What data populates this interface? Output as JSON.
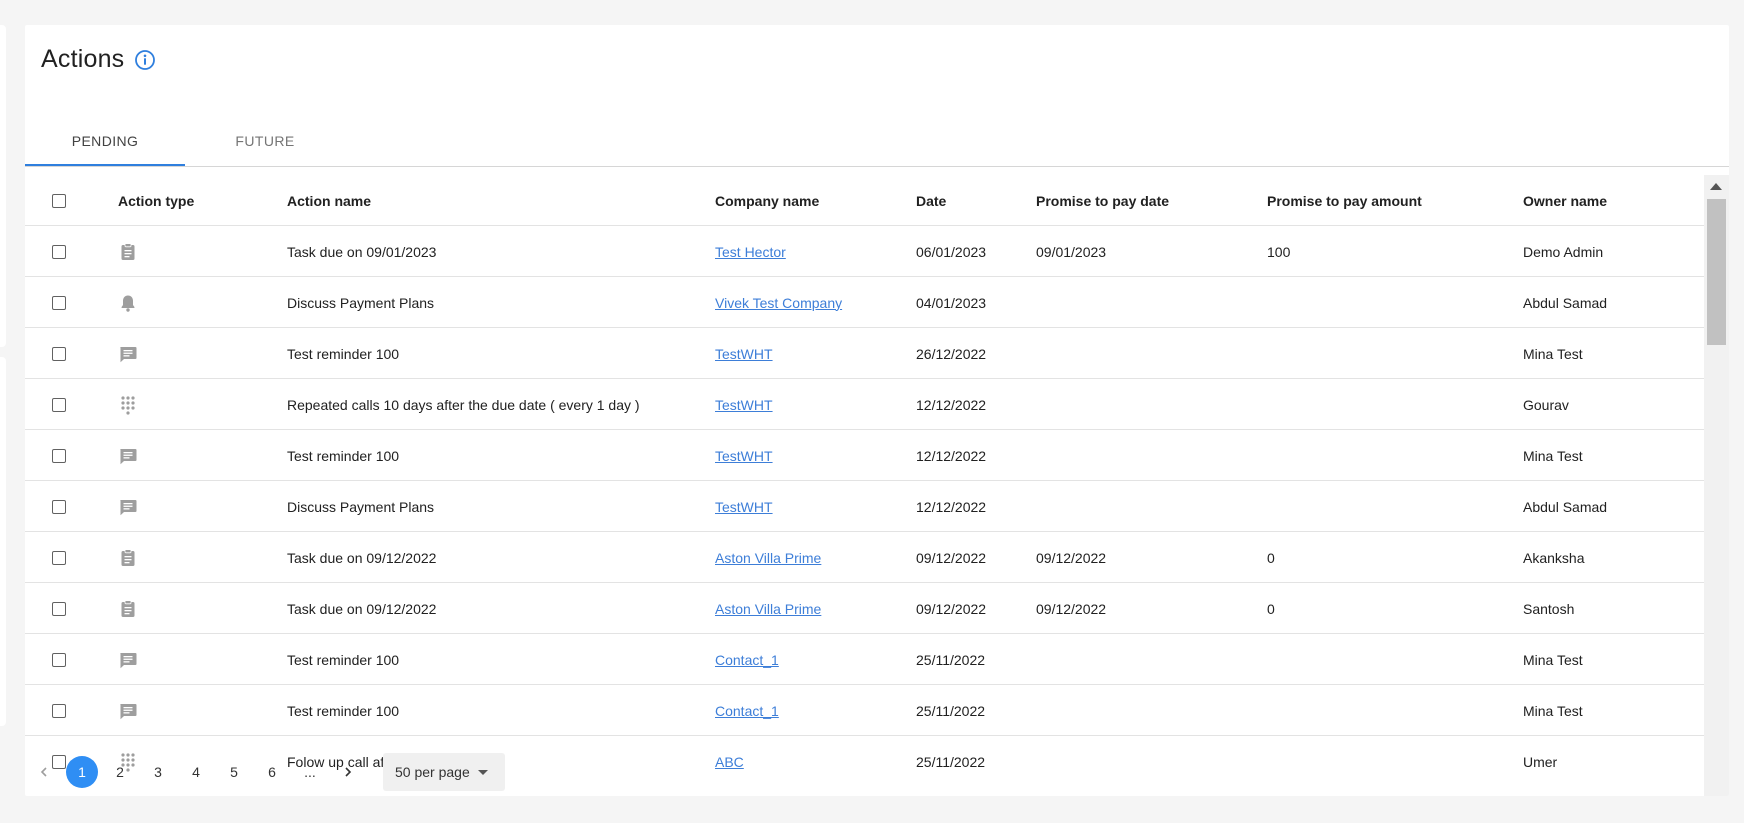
{
  "page": {
    "title": "Actions",
    "info_icon": "info-icon"
  },
  "tabs": [
    {
      "label": "PENDING",
      "active": true
    },
    {
      "label": "FUTURE",
      "active": false
    }
  ],
  "table": {
    "columns": [
      "Action type",
      "Action name",
      "Company name",
      "Date",
      "Promise to pay date",
      "Promise to pay amount",
      "Owner name"
    ],
    "rows": [
      {
        "type": "task",
        "name": "Task due on 09/01/2023",
        "company": "Test Hector",
        "date": "06/01/2023",
        "ptp_date": "09/01/2023",
        "ptp_amount": "100",
        "owner": "Demo Admin"
      },
      {
        "type": "notification",
        "name": "Discuss Payment Plans",
        "company": "Vivek Test Company",
        "date": "04/01/2023",
        "ptp_date": "",
        "ptp_amount": "",
        "owner": "Abdul Samad"
      },
      {
        "type": "message",
        "name": "Test reminder 100",
        "company": "TestWHT",
        "date": "26/12/2022",
        "ptp_date": "",
        "ptp_amount": "",
        "owner": "Mina Test"
      },
      {
        "type": "dialpad",
        "name": "Repeated calls 10 days after the due date ( every 1 day )",
        "company": "TestWHT",
        "date": "12/12/2022",
        "ptp_date": "",
        "ptp_amount": "",
        "owner": "Gourav"
      },
      {
        "type": "message",
        "name": "Test reminder 100",
        "company": "TestWHT",
        "date": "12/12/2022",
        "ptp_date": "",
        "ptp_amount": "",
        "owner": "Mina Test"
      },
      {
        "type": "message",
        "name": "Discuss Payment Plans",
        "company": "TestWHT",
        "date": "12/12/2022",
        "ptp_date": "",
        "ptp_amount": "",
        "owner": "Abdul Samad"
      },
      {
        "type": "task",
        "name": "Task due on 09/12/2022",
        "company": "Aston Villa Prime",
        "date": "09/12/2022",
        "ptp_date": "09/12/2022",
        "ptp_amount": "0",
        "owner": "Akanksha"
      },
      {
        "type": "task",
        "name": "Task due on 09/12/2022",
        "company": "Aston Villa Prime",
        "date": "09/12/2022",
        "ptp_date": "09/12/2022",
        "ptp_amount": "0",
        "owner": "Santosh"
      },
      {
        "type": "message",
        "name": "Test reminder 100",
        "company": "Contact_1",
        "date": "25/11/2022",
        "ptp_date": "",
        "ptp_amount": "",
        "owner": "Mina Test"
      },
      {
        "type": "message",
        "name": "Test reminder 100",
        "company": "Contact_1",
        "date": "25/11/2022",
        "ptp_date": "",
        "ptp_amount": "",
        "owner": "Mina Test"
      },
      {
        "type": "dialpad",
        "name": "Folow up call after due",
        "company": "ABC",
        "date": "25/11/2022",
        "ptp_date": "",
        "ptp_amount": "",
        "owner": "Umer"
      }
    ]
  },
  "pagination": {
    "pages": [
      "1",
      "2",
      "3",
      "4",
      "5",
      "6",
      "..."
    ],
    "current": "1",
    "per_page": "50 per page"
  },
  "colors": {
    "accent": "#2f7fde",
    "link": "#3d7ed8",
    "icon_gray": "#9e9e9e"
  }
}
